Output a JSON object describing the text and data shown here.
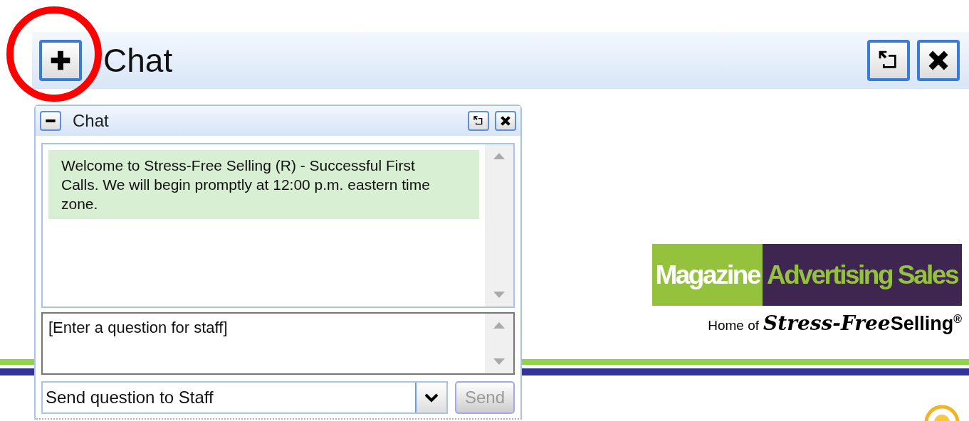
{
  "header": {
    "title": "Chat"
  },
  "chat": {
    "title": "Chat",
    "messages": [
      {
        "text": "Welcome to Stress-Free Selling (R) - Successful First Calls. We will begin promptly at 12:00 p.m. eastern time zone."
      }
    ],
    "question": {
      "placeholder": "[Enter a question for staff]"
    },
    "recipient": {
      "value": "Send question to Staff"
    },
    "send": {
      "label": "Send",
      "disabled": true
    }
  },
  "logo": {
    "left": "Magazine",
    "right": "Advertising Sales",
    "tagline_prefix": "Home of",
    "tagline_script": "Stress-Free",
    "tagline_brand": "Selling$^{®}$"
  }
}
